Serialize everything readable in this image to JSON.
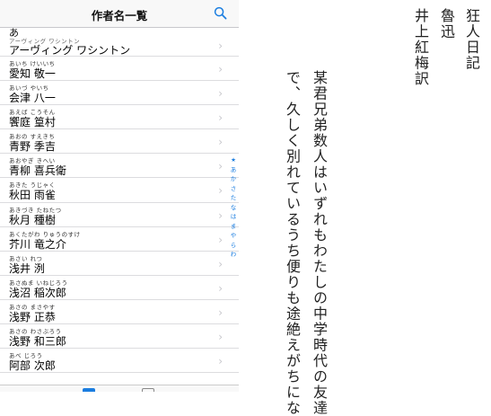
{
  "navbar": {
    "title": "作者名一覧"
  },
  "section": {
    "header": "あ"
  },
  "authors": [
    {
      "reading": "アーヴィング ワシントン",
      "name": "アーヴィング ワシントン"
    },
    {
      "reading": "あいち けいいち",
      "name": "愛知 敬一"
    },
    {
      "reading": "あいづ やいち",
      "name": "会津 八一"
    },
    {
      "reading": "あえば こうそん",
      "name": "饗庭 篁村"
    },
    {
      "reading": "あおの すえきち",
      "name": "青野 季吉"
    },
    {
      "reading": "あおやぎ きへい",
      "name": "青柳 喜兵衛"
    },
    {
      "reading": "あきた うじゃく",
      "name": "秋田 雨雀"
    },
    {
      "reading": "あきづき たねたつ",
      "name": "秋月 種樹"
    },
    {
      "reading": "あくたがわ りゅうのすけ",
      "name": "芥川 竜之介"
    },
    {
      "reading": "あさい れつ",
      "name": "浅井 洌"
    },
    {
      "reading": "あさぬま いねじろう",
      "name": "浅沼 稲次郎"
    },
    {
      "reading": "あさの まさやす",
      "name": "浅野 正恭"
    },
    {
      "reading": "あさの わさぶろう",
      "name": "浅野 和三郎"
    },
    {
      "reading": "あべ じろう",
      "name": "阿部 次郎"
    }
  ],
  "index": [
    "★",
    "あ",
    "か",
    "さ",
    "た",
    "な",
    "は",
    "ま",
    "や",
    "ら",
    "わ"
  ],
  "reader": {
    "title": "狂人日記",
    "author": "魯迅",
    "translator": "井上紅梅訳",
    "line1": "某君兄弟数人はいずれもわたしの中学時代の友達",
    "line2": "で、久しく別れているうち便りも途絶えがちにな"
  },
  "icons": {
    "search": "search-icon",
    "chevron": "chevron-right-icon"
  },
  "colors": {
    "accent": "#1a7de0",
    "separator": "#dcdcdf",
    "chevron": "#c7c7cc"
  }
}
